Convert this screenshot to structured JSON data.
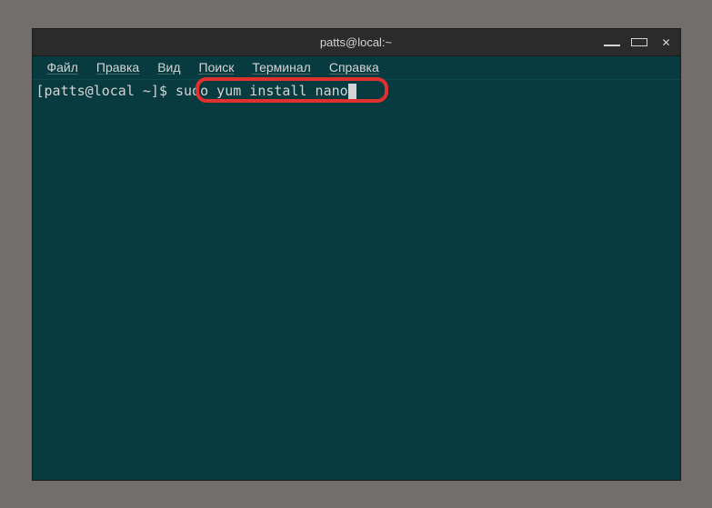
{
  "window": {
    "title": "patts@local:~"
  },
  "window_controls": {
    "minimize": "minimize",
    "maximize": "maximize",
    "close": "close"
  },
  "menubar": {
    "items": [
      {
        "label": "Файл"
      },
      {
        "label": "Правка"
      },
      {
        "label": "Вид"
      },
      {
        "label": "Поиск"
      },
      {
        "label": "Терминал"
      },
      {
        "label": "Справка"
      }
    ]
  },
  "terminal": {
    "prompt": "[patts@local ~]$ ",
    "command": "sudo yum install nano"
  },
  "highlight": {
    "color": "#e03030"
  }
}
